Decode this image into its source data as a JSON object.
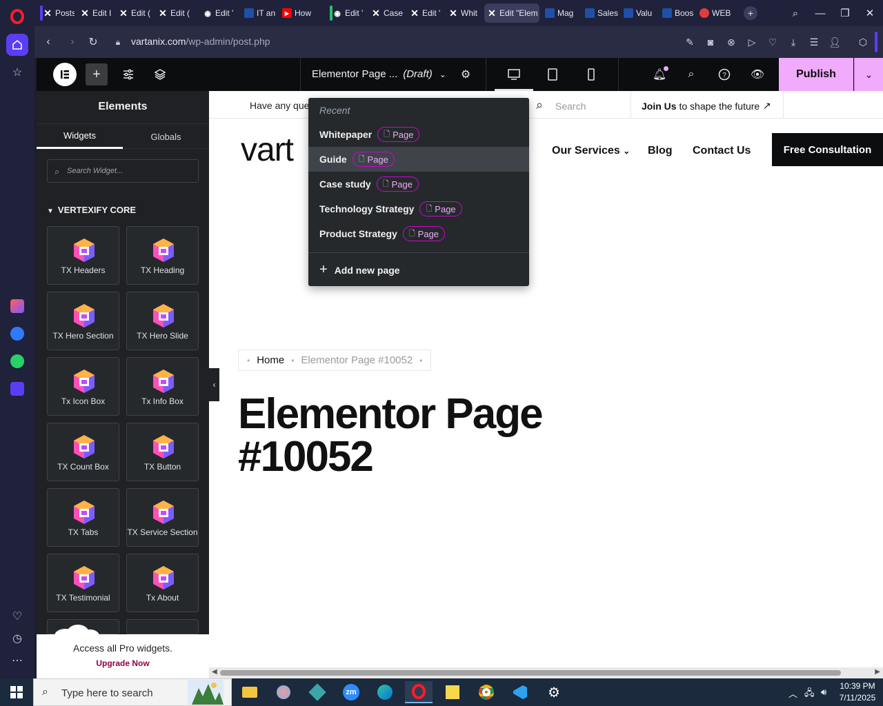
{
  "browser": {
    "tabs": [
      {
        "label": "Posts",
        "fav": "wordpress-x-icon"
      },
      {
        "label": "Edit I",
        "fav": "wordpress-x-icon"
      },
      {
        "label": "Edit (",
        "fav": "wordpress-x-icon"
      },
      {
        "label": "Edit (",
        "fav": "wordpress-x-icon"
      },
      {
        "label": "Edit '",
        "fav": "globe-icon"
      },
      {
        "label": "IT an",
        "fav": "blue-square-icon"
      },
      {
        "label": "How",
        "fav": "youtube-icon"
      },
      {
        "label": "Edit '",
        "fav": "globe-icon"
      },
      {
        "label": "Case",
        "fav": "wordpress-x-icon"
      },
      {
        "label": "Edit '",
        "fav": "wordpress-x-icon"
      },
      {
        "label": "Whit",
        "fav": "wordpress-x-icon"
      },
      {
        "label": "Edit \"Elem",
        "fav": "wordpress-x-icon"
      },
      {
        "label": "Mag",
        "fav": "blue-square-icon"
      },
      {
        "label": "Sales",
        "fav": "blue-square-icon"
      },
      {
        "label": "Valu",
        "fav": "blue-square-icon"
      },
      {
        "label": "Boos",
        "fav": "blue-square-icon"
      },
      {
        "label": "WEB",
        "fav": "red-logo-icon"
      }
    ],
    "url_domain": "vartanix.com",
    "url_path": "/wp-admin/post.php"
  },
  "elementor": {
    "doc_title": "Elementor Page ...",
    "doc_status": "(Draft)",
    "publish_label": "Publish",
    "panel_title": "Elements",
    "tabs": [
      "Widgets",
      "Globals"
    ],
    "search_placeholder": "Search Widget...",
    "category": "VERTEXIFY CORE",
    "widgets": [
      "TX Headers",
      "TX Heading",
      "TX Hero Section",
      "TX Hero Slide",
      "Tx Icon Box",
      "Tx Info Box",
      "TX Count Box",
      "TX Button",
      "TX Tabs",
      "TX Service Section",
      "TX Testimonial",
      "Tx About"
    ],
    "pro_text": "Access all Pro widgets.",
    "pro_link": "Upgrade Now"
  },
  "recent_dropdown": {
    "heading": "Recent",
    "items": [
      {
        "title": "Whitepaper",
        "type": "Page"
      },
      {
        "title": "Guide",
        "type": "Page"
      },
      {
        "title": "Case study",
        "type": "Page"
      },
      {
        "title": "Technology Strategy",
        "type": "Page"
      },
      {
        "title": "Product Strategy",
        "type": "Page"
      }
    ],
    "add_label": "Add new page"
  },
  "site": {
    "topbar_text": "Have any que",
    "search_placeholder": "Search",
    "join_bold": "Join Us",
    "join_rest": " to shape the future",
    "logo": "vart",
    "nav": {
      "services": "Our Services",
      "blog": "Blog",
      "contact": "Contact Us"
    },
    "cta": "Free Consultation",
    "breadcrumb": {
      "home": "Home",
      "current": "Elementor Page #10052"
    },
    "page_title": "Elementor Page #10052"
  },
  "taskbar": {
    "search_text": "Type here to search",
    "time": "10:39 PM",
    "date": "7/11/2025"
  },
  "colors": {
    "publish": "#f0abfc",
    "badge_border": "#d004d4",
    "upgrade_link": "#93003f"
  }
}
